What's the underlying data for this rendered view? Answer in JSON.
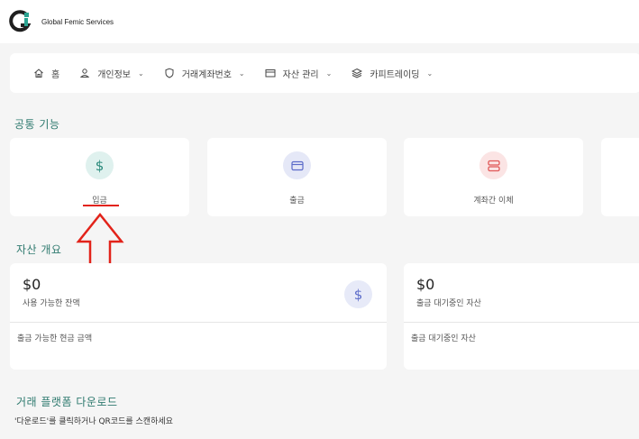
{
  "header": {
    "brand_name": "Global Femic Services",
    "logo_icon": "gfs-logo-icon",
    "colors": {
      "logo_dark": "#1f1f1f",
      "logo_accent": "#2aa391"
    }
  },
  "nav": {
    "items": [
      {
        "label": "홈",
        "icon": "home-icon",
        "has_dropdown": false
      },
      {
        "label": "개인정보",
        "icon": "user-icon",
        "has_dropdown": true
      },
      {
        "label": "거래계좌번호",
        "icon": "shield-icon",
        "has_dropdown": true
      },
      {
        "label": "자산 관리",
        "icon": "wallet-icon",
        "has_dropdown": true
      },
      {
        "label": "카피트레이딩",
        "icon": "layers-icon",
        "has_dropdown": true
      }
    ],
    "chevron_glyph": "⌄"
  },
  "common_functions": {
    "title": "공통 기능",
    "cards": [
      {
        "label": "입금",
        "icon": "dollar-icon",
        "icon_bg": "#dff1ee",
        "icon_color": "#2a8a7b"
      },
      {
        "label": "출금",
        "icon": "card-icon",
        "icon_bg": "#e5e8f7",
        "icon_color": "#5b6bc9"
      },
      {
        "label": "계좌간 이체",
        "icon": "transfer-icon",
        "icon_bg": "#fbe4e4",
        "icon_color": "#e05656"
      }
    ]
  },
  "asset_overview": {
    "title": "자산 개요",
    "cards": [
      {
        "amount": "$0",
        "subtitle": "사용 가능한 잔액",
        "footer": "출금 가능한 현금 금액",
        "badge_icon": "dollar-icon",
        "badge_glyph": "$"
      },
      {
        "amount": "$0",
        "subtitle": "출금 대기중인 자산",
        "footer": "출금 대기중인 자산"
      }
    ]
  },
  "download": {
    "title": "거래 플랫폼 다운로드",
    "subtitle": "'다운로드'를 클릭하거나 QR코드를 스캔하세요"
  },
  "annotation": {
    "color": "#e2231a",
    "target": "입금"
  }
}
